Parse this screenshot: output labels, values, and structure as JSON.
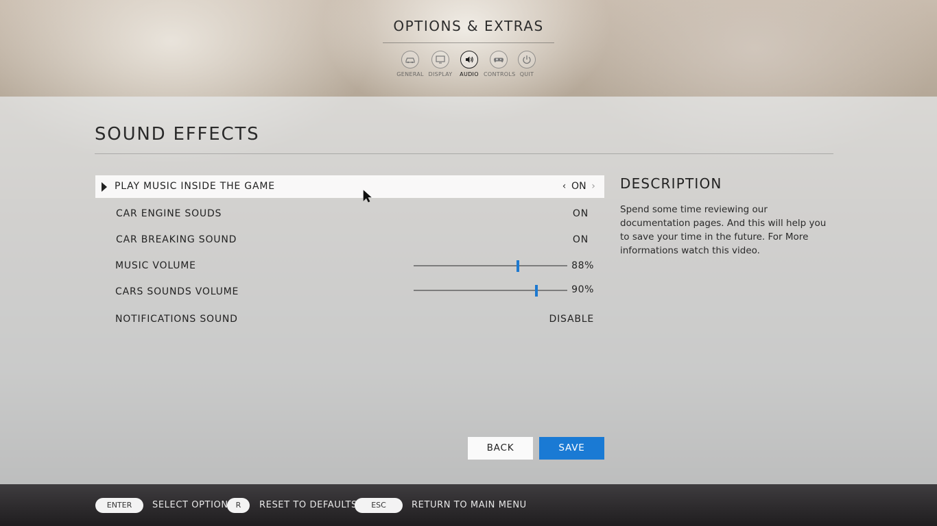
{
  "header": {
    "title": "OPTIONS & EXTRAS",
    "nav": [
      {
        "label": "GENERAL",
        "icon": "car-icon"
      },
      {
        "label": "DISPLAY",
        "icon": "monitor-icon"
      },
      {
        "label": "AUDIO",
        "icon": "speaker-icon",
        "active": true
      },
      {
        "label": "CONTROLS",
        "icon": "gamepad-icon"
      },
      {
        "label": "QUIT",
        "icon": "power-icon"
      }
    ]
  },
  "section": {
    "title": "SOUND EFFECTS"
  },
  "settings": [
    {
      "label": "PLAY MUSIC INSIDE THE GAME",
      "value": "ON",
      "selected": true
    },
    {
      "label": "CAR ENGINE SOUDS",
      "value": "ON"
    },
    {
      "label": "CAR BREAKING SOUND",
      "value": "ON"
    },
    {
      "label": "MUSIC VOLUME",
      "value": "88%",
      "level": 0.68
    },
    {
      "label": "CARS SOUNDS VOLUME",
      "value": "90%",
      "level": 0.8
    },
    {
      "label": "NOTIFICATIONS SOUND",
      "value": "DISABLE"
    }
  ],
  "description": {
    "title": "DESCRIPTION",
    "text": "Spend some time reviewing our documentation pages. And this will help you to save your time in the future. For More informations watch this video."
  },
  "buttons": {
    "back": "BACK",
    "save": "SAVE"
  },
  "footer": {
    "hints": [
      {
        "key": "ENTER",
        "label": "SELECT OPTION"
      },
      {
        "key": "R",
        "label": "RESET TO DEFAULTS"
      },
      {
        "key": "ESC",
        "label": "RETURN TO MAIN MENU"
      }
    ]
  },
  "colors": {
    "accent": "#1a7ad4",
    "slider_thumb": "#1d79d0"
  }
}
